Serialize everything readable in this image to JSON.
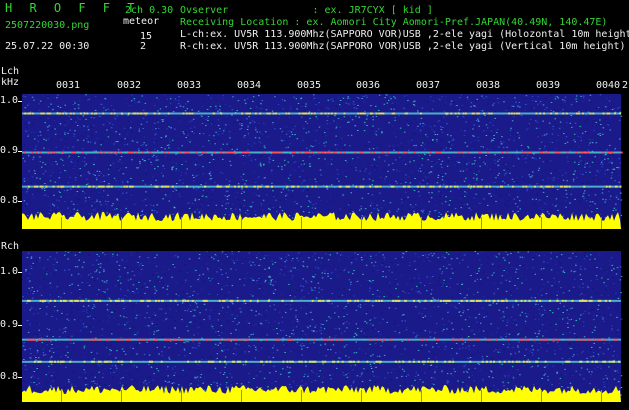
{
  "header": {
    "title": "H R O F F T",
    "channel_mode": "2ch 0.30",
    "filename": "2507220030.png",
    "detector": "meteor",
    "count_l": "15",
    "count_r": "2",
    "datetime": "25.07.22 00:30"
  },
  "info": {
    "observer": "Ovserver              : ex. JR7CYX [ kid ]",
    "location": "Receiving Location : ex. Aomori City Aomori-Pref.JAPAN(40.49N, 140.47E)",
    "lch": "L-ch:ex. UV5R 113.900Mhz(SAPPORO VOR)USB ,2-ele yagi (Holozontal 10m height)",
    "rch": "R-ch:ex. UV5R 113.900Mhz(SAPPORO VOR)USB ,2-ele yagi (Vertical 10m height)"
  },
  "time_ticks": [
    "0031",
    "0032",
    "0033",
    "0034",
    "0035",
    "0036",
    "0037",
    "0038",
    "0039",
    "0040"
  ],
  "time_tick_extra": "2",
  "lch_panel": {
    "label": "Lch",
    "unit": "kHz",
    "freq_ticks": [
      "1.0",
      "0.9",
      "0.8"
    ]
  },
  "rch_panel": {
    "label": "Rch",
    "freq_ticks": [
      "1.0",
      "0.9",
      "0.8"
    ]
  },
  "colors": {
    "background": "#000000",
    "header_green": "#33d633",
    "text_white": "#f0f0f0",
    "spectrogram_base": "#1a1a8a",
    "signal_level": "#ffff00",
    "tick_marker": "#00c8c8"
  },
  "chart_data": [
    {
      "type": "heatmap",
      "title": "Lch",
      "ylabel": "kHz",
      "x_ticks": [
        "0031",
        "0032",
        "0033",
        "0034",
        "0035",
        "0036",
        "0037",
        "0038",
        "0039",
        "0040"
      ],
      "y_ticks": [
        "1.0",
        "0.9",
        "0.8"
      ],
      "ylim": [
        0.78,
        1.02
      ],
      "carrier_lines_khz": [
        0.98,
        0.9,
        0.83
      ]
    },
    {
      "type": "heatmap",
      "title": "Rch",
      "x_ticks": [],
      "y_ticks": [
        "1.0",
        "0.9",
        "0.8"
      ],
      "ylim": [
        0.78,
        1.02
      ],
      "carrier_lines_khz": [
        0.93,
        0.86,
        0.82
      ]
    }
  ]
}
